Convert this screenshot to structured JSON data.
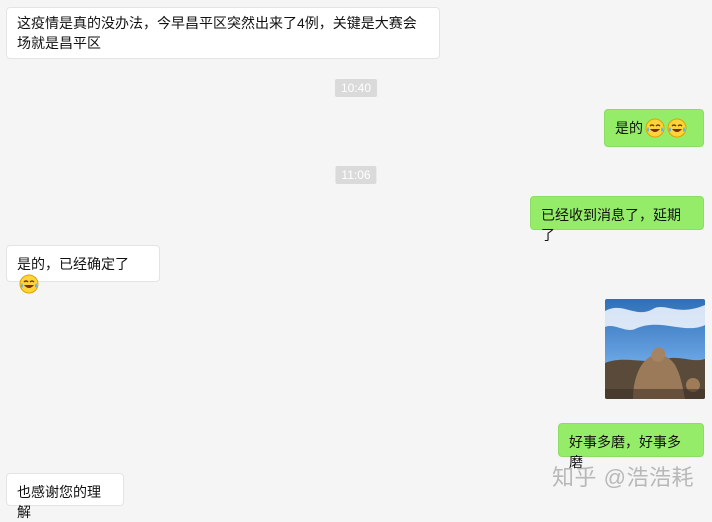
{
  "messages": [
    {
      "side": "left",
      "text": "这疫情是真的没办法，今早昌平区突然出来了4例，关键是大赛会场就是昌平区"
    },
    {
      "side": "right",
      "text": "是的"
    },
    {
      "side": "right",
      "text": "已经收到消息了，延期了"
    },
    {
      "side": "left",
      "text": "是的，已经确定了"
    },
    {
      "side": "right",
      "text": "好事多磨，好事多磨"
    },
    {
      "side": "left",
      "text": "也感谢您的理解"
    }
  ],
  "timestamps": [
    "10:40",
    "11:06"
  ],
  "watermark": "知乎 @浩浩耗",
  "colors": {
    "background": "#f5f5f5",
    "self_bubble": "#95ec69",
    "other_bubble": "#ffffff",
    "timestamp_bg": "#dadada"
  },
  "icons": [
    "laugh-cry-emoji",
    "image-message"
  ]
}
